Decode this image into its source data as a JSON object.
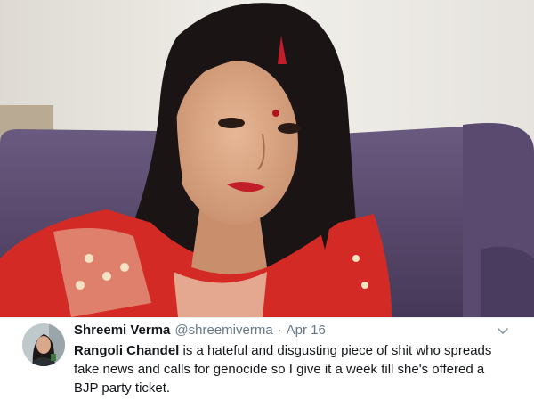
{
  "tweet": {
    "display_name": "Shreemi Verma",
    "handle": "@shreemiverma",
    "separator": "·",
    "date": "Apr 16",
    "text_bold": "Rangoli Chandel",
    "text_line1": " is a hateful and disgusting piece of shit who spreads",
    "text_line2": "fake news and calls for genocide so I give it a week till she's offered a",
    "text_line3": "BJP party ticket.",
    "menu_icon": "chevron-down-icon",
    "avatar_icon": "avatar"
  },
  "colors": {
    "name": "#14171a",
    "secondary_text": "#657786",
    "divider": "#e6ecf0",
    "sofa": "#5b4a6f",
    "dress": "#d42a25"
  }
}
